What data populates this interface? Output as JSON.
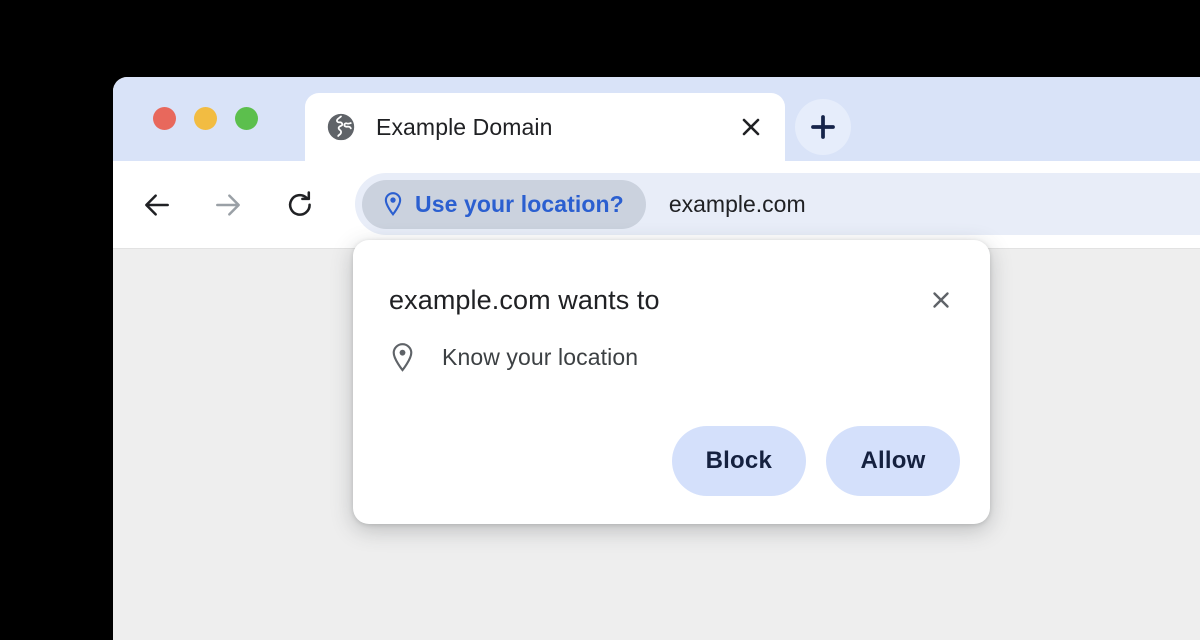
{
  "window": {
    "traffic_lights": [
      {
        "name": "close",
        "color": "#e8685c"
      },
      {
        "name": "minimize",
        "color": "#f2bc42"
      },
      {
        "name": "maximize",
        "color": "#5cbf4d"
      }
    ]
  },
  "tabs": {
    "active": {
      "title": "Example Domain",
      "favicon": "globe-icon",
      "close_icon": "close-icon"
    },
    "new_tab_icon": "plus-icon"
  },
  "toolbar": {
    "back_icon": "arrow-left-icon",
    "forward_icon": "arrow-right-icon",
    "reload_icon": "reload-icon",
    "omnibox": {
      "chip": {
        "icon": "location-pin-icon",
        "label": "Use your location?",
        "text_color": "#2b5fd0",
        "background": "#cbd2de"
      },
      "url": "example.com",
      "background": "#e8edf8"
    }
  },
  "dialog": {
    "title": "example.com wants to",
    "close_icon": "close-icon",
    "permission": {
      "icon": "location-pin-icon",
      "label": "Know your location"
    },
    "buttons": [
      {
        "name": "block",
        "label": "Block"
      },
      {
        "name": "allow",
        "label": "Allow"
      }
    ],
    "button_background": "#d4e0fb",
    "button_text_color": "#15213f"
  },
  "colors": {
    "tab_strip": "#d9e3f8",
    "toolbar": "#ffffff",
    "page_background": "#eeeeee",
    "accent_blue": "#2b5fd0"
  }
}
